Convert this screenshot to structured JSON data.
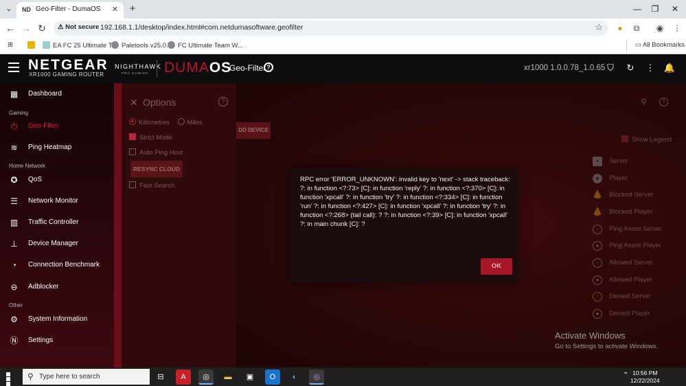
{
  "browser": {
    "tab_title": "Geo-Filter - DumaOS",
    "tab_favicon": "ND",
    "new_tab": "+",
    "tab_list": "⌄",
    "security": "Not secure",
    "url": "192.168.1.1/desktop/index.html#com.netdumasoftware.geofilter",
    "bookmarks": [
      {
        "label": "EA FC 25 Ultimate T..."
      },
      {
        "label": "Paletools v25.0.3"
      },
      {
        "label": "FC Ultimate Team W..."
      }
    ],
    "all_bookmarks": "All Bookmarks"
  },
  "header": {
    "brand": "NETGEAR",
    "brand_sub": "XR1000 GAMING ROUTER",
    "nighthawk": "NIGHTHAWK",
    "nighthawk_sub": "PRO GAMING",
    "duma_part1": "DUMA",
    "duma_part2": "OS",
    "page_title": "Geo-Filter",
    "firmware": "xr1000 1.0.0.78_1.0.65"
  },
  "sidebar": {
    "items": [
      {
        "label": "Dashboard",
        "icon": "dashboard-icon"
      },
      {
        "section": "Gaming"
      },
      {
        "label": "Geo-Filter",
        "icon": "geo-filter-icon",
        "active": true
      },
      {
        "label": "Ping Heatmap",
        "icon": "ping-heatmap-icon"
      },
      {
        "section": "Home Network"
      },
      {
        "label": "QoS",
        "icon": "qos-icon"
      },
      {
        "label": "Network Monitor",
        "icon": "network-monitor-icon"
      },
      {
        "label": "Traffic Controller",
        "icon": "traffic-controller-icon"
      },
      {
        "label": "Device Manager",
        "icon": "device-manager-icon"
      },
      {
        "label": "Connection Benchmark",
        "icon": "benchmark-icon"
      },
      {
        "label": "Adblocker",
        "icon": "adblocker-icon"
      },
      {
        "section": "Other"
      },
      {
        "label": "System Information",
        "icon": "system-info-icon"
      },
      {
        "label": "Settings",
        "icon": "settings-icon"
      }
    ],
    "labels": {
      "dashboard": "Dashboard",
      "gaming": "Gaming",
      "geo_filter": "Geo-Filter",
      "ping_heatmap": "Ping Heatmap",
      "home_network": "Home Network",
      "qos": "QoS",
      "network_monitor": "Network Monitor",
      "traffic_controller": "Traffic Controller",
      "device_manager": "Device Manager",
      "connection_benchmark": "Connection Benchmark",
      "adblocker": "Adblocker",
      "other": "Other",
      "system_information": "System Information",
      "settings": "Settings"
    }
  },
  "options": {
    "title": "Options",
    "kilometres": "Kilometres",
    "miles": "Miles",
    "strict_mode": "Strict Mode",
    "auto_ping_host": "Auto Ping Host",
    "resync_cloud": "RESYNC CLOUD",
    "fast_search": "Fast Search",
    "unit_selected": "Kilometres",
    "strict_mode_checked": true,
    "auto_ping_host_checked": false,
    "fast_search_checked": false
  },
  "map": {
    "add_device": "DD DEVICE",
    "show_legend": "Show Legend",
    "legend": {
      "server": "Server",
      "player": "Player",
      "blocked_server": "Blocked Server",
      "blocked_player": "Blocked Player",
      "ping_assist_server": "Ping Assist Server",
      "ping_assist_player": "Ping Assist Player",
      "allowed_server": "Allowed Server",
      "allowed_player": "Allowed Player",
      "denied_server": "Denied Server",
      "denied_player": "Denied Player"
    }
  },
  "modal": {
    "message": "RPC error 'ERROR_UNKNOWN': invalid key to 'next' -> stack traceback: ?: in function <?:73> [C]: in function 'reply' ?: in function <?:370> [C]: in function 'xpcall' ?: in function 'try' ?: in function <?:334> [C]: in function 'run' ?: in function <?:427> [C]: in function 'xpcall' ?: in function 'try' ?: in function <?:268> (tail call): ? ?: in function <?:39> [C]: in function 'xpcall' ?: in main chunk [C]: ?",
    "ok": "OK"
  },
  "watermark": {
    "title": "Activate Windows",
    "subtitle": "Go to Settings to activate Windows."
  },
  "taskbar": {
    "search_placeholder": "Type here to search",
    "time": "10:56 PM",
    "date": "12/22/2024"
  },
  "colors": {
    "accent": "#e51c35",
    "ok_button": "#a6172a"
  }
}
